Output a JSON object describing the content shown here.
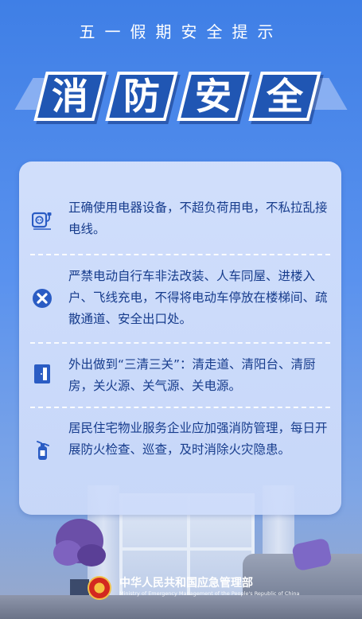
{
  "header": {
    "subtitle": "五一假期安全提示",
    "title_chars": [
      "消",
      "防",
      "安",
      "全"
    ]
  },
  "tips": [
    {
      "icon": "socket-plug-icon",
      "text": "正确使用电器设备，不超负荷用电，不私拉乱接电线。"
    },
    {
      "icon": "cross-circle-icon",
      "text": "严禁电动自行车非法改装、人车同屋、进楼入户、飞线充电，不得将电动车停放在楼梯间、疏散通道、安全出口处。"
    },
    {
      "icon": "door-icon",
      "text": "外出做到“三清三关”：清走道、清阳台、清厨房，关火源、关气源、关电源。"
    },
    {
      "icon": "fire-extinguisher-icon",
      "text": "居民住宅物业服务企业应加强消防管理，每日开展防火检查、巡查，及时消除火灾隐患。"
    }
  ],
  "footer": {
    "ministry_name": "中华人民共和国应急管理部",
    "ministry_name_en": "Ministry of Emergency Management of the People's Republic of China"
  },
  "colors": {
    "background": "#4a86ea",
    "title_box": "#2056b3",
    "tip_text": "#173c8c",
    "icon_blue": "#2a5cc4"
  }
}
